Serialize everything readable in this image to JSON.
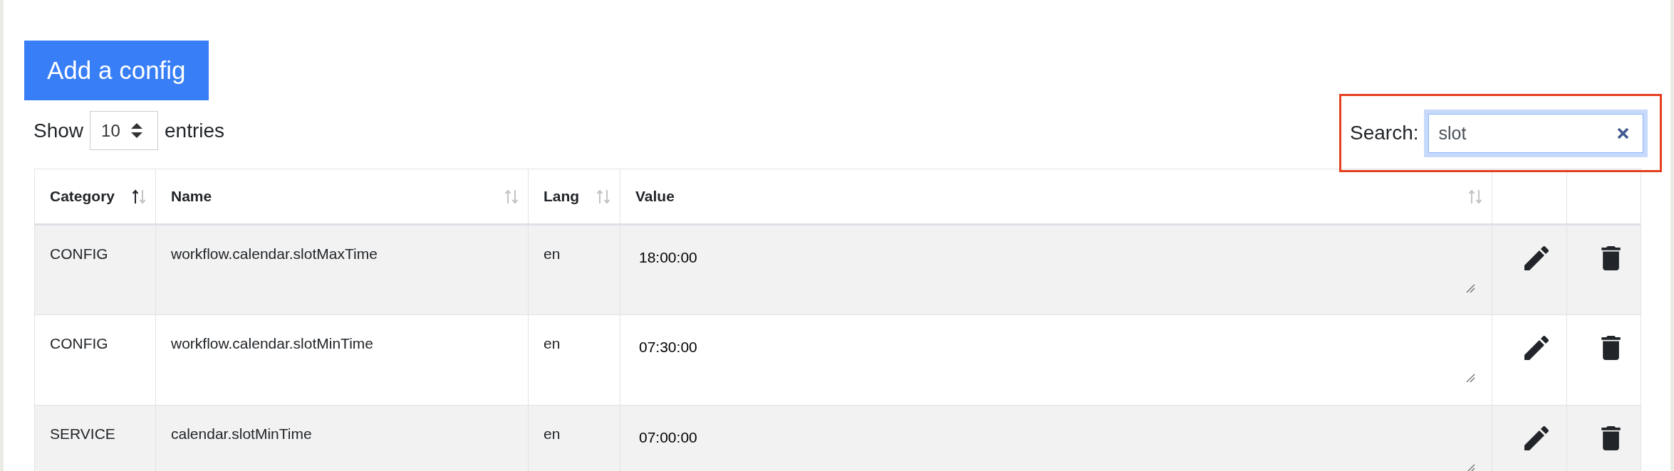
{
  "add_button": {
    "label": "Add a config"
  },
  "length_menu": {
    "prefix": "Show",
    "value": "10",
    "suffix": "entries"
  },
  "search": {
    "label": "Search:",
    "value": "slot",
    "focused": true,
    "highlighted": true
  },
  "table": {
    "columns": [
      {
        "kind": "text",
        "label": "Category",
        "sorted_ascending": true
      },
      {
        "kind": "text",
        "label": "Name",
        "sorted_ascending": false
      },
      {
        "kind": "text",
        "label": "Lang",
        "sorted_ascending": false
      },
      {
        "kind": "textarea",
        "label": "Value",
        "sorted_ascending": false
      },
      {
        "kind": "edit"
      },
      {
        "kind": "delete"
      }
    ],
    "rows": [
      {
        "cells": [
          "CONFIG",
          "workflow.calendar.slotMaxTime",
          "en",
          "18:00:00"
        ]
      },
      {
        "cells": [
          "CONFIG",
          "workflow.calendar.slotMinTime",
          "en",
          "07:30:00"
        ]
      },
      {
        "cells": [
          "SERVICE",
          "calendar.slotMinTime",
          "en",
          "07:00:00"
        ]
      }
    ]
  }
}
